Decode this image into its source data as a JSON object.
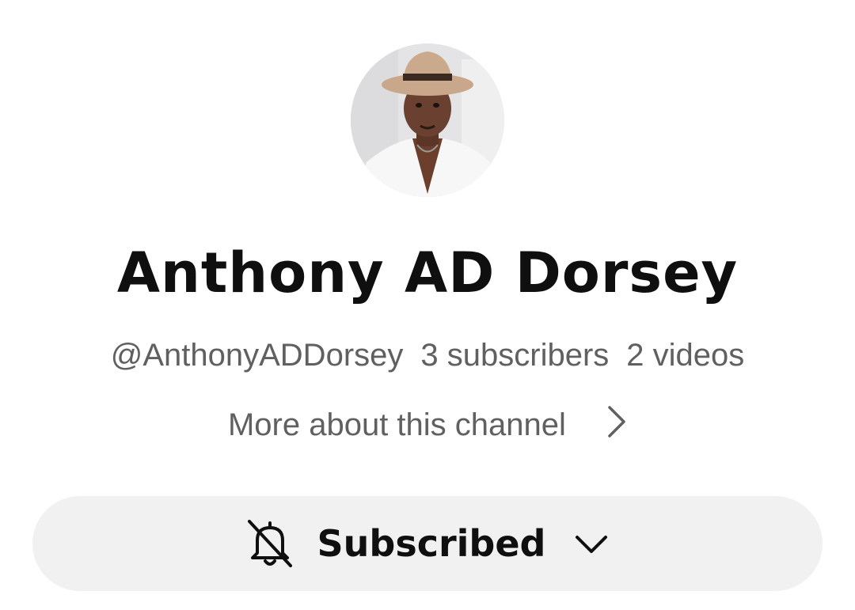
{
  "channel": {
    "name": "Anthony AD Dorsey",
    "handle": "@AnthonyADDorsey",
    "subscribers": "3 subscribers",
    "videos": "2 videos"
  },
  "about": {
    "label": "More about this channel"
  },
  "subscribe": {
    "label": "Subscribed"
  },
  "icons": {
    "avatar": "avatar",
    "chevron": "chevron-right-icon",
    "bell": "bell-off-icon",
    "caret": "chevron-down-icon"
  }
}
